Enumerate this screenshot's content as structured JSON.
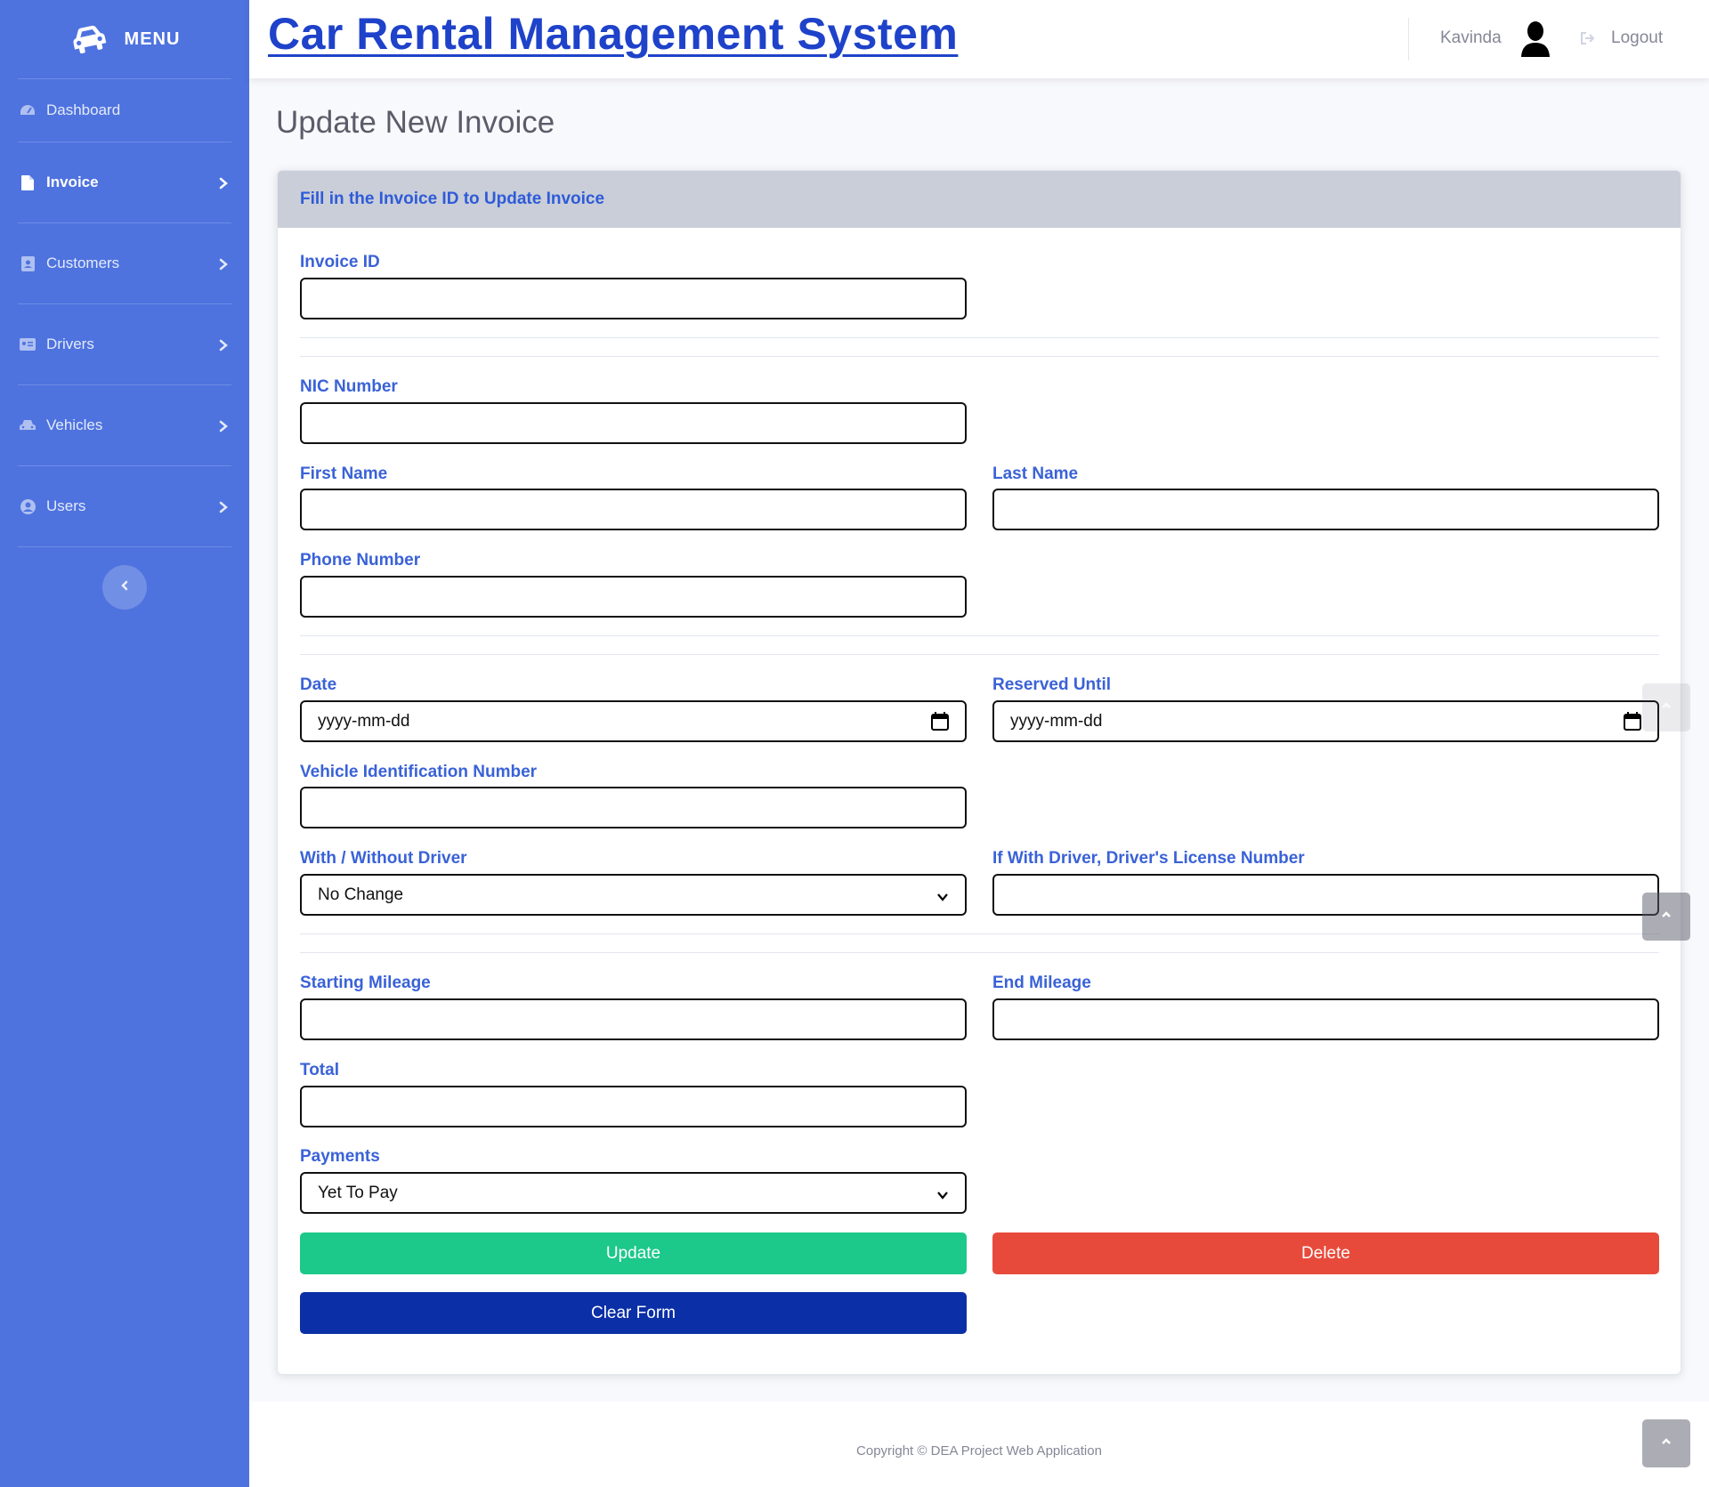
{
  "brand": {
    "label": "MENU",
    "icon": "car-icon"
  },
  "sidebar": {
    "items": [
      {
        "label": "Dashboard",
        "icon": "tachometer-icon",
        "active": false
      },
      {
        "label": "Invoice",
        "icon": "file-icon",
        "active": true
      },
      {
        "label": "Customers",
        "icon": "address-book-icon",
        "active": false
      },
      {
        "label": "Drivers",
        "icon": "id-card-icon",
        "active": false
      },
      {
        "label": "Vehicles",
        "icon": "car-icon",
        "active": false
      },
      {
        "label": "Users",
        "icon": "user-circle-icon",
        "active": false
      }
    ],
    "toggle_icon": "chevron-left-icon"
  },
  "header": {
    "title": "Car Rental Management System",
    "user_name": "Kavinda",
    "logout_label": "Logout"
  },
  "page": {
    "heading": "Update New Invoice"
  },
  "card": {
    "header": "Fill in the Invoice ID to Update Invoice"
  },
  "form": {
    "invoice_id": {
      "label": "Invoice ID",
      "value": ""
    },
    "nic": {
      "label": "NIC Number",
      "value": ""
    },
    "first_name": {
      "label": "First Name",
      "value": ""
    },
    "last_name": {
      "label": "Last Name",
      "value": ""
    },
    "phone": {
      "label": "Phone Number",
      "value": ""
    },
    "date": {
      "label": "Date",
      "placeholder": "yyyy-mm-dd"
    },
    "reserved_until": {
      "label": "Reserved Until",
      "placeholder": "yyyy-mm-dd"
    },
    "vin": {
      "label": "Vehicle Identification Number",
      "value": ""
    },
    "driver_option": {
      "label": "With / Without Driver",
      "selected": "No Change"
    },
    "driver_license": {
      "label": "If With Driver, Driver's License Number",
      "value": ""
    },
    "start_mileage": {
      "label": "Starting Mileage",
      "value": ""
    },
    "end_mileage": {
      "label": "End Mileage",
      "value": ""
    },
    "total": {
      "label": "Total",
      "value": ""
    },
    "payments": {
      "label": "Payments",
      "selected": "Yet To Pay"
    }
  },
  "buttons": {
    "update": "Update",
    "delete": "Delete",
    "clear": "Clear Form"
  },
  "footer": {
    "text": "Copyright © DEA Project Web Application"
  },
  "colors": {
    "sidebar": "#4e73df",
    "title": "#1e42c9",
    "label": "#3a62d7",
    "update": "#1cc88a",
    "delete": "#e74a3b",
    "clear": "#0a2fa6"
  }
}
